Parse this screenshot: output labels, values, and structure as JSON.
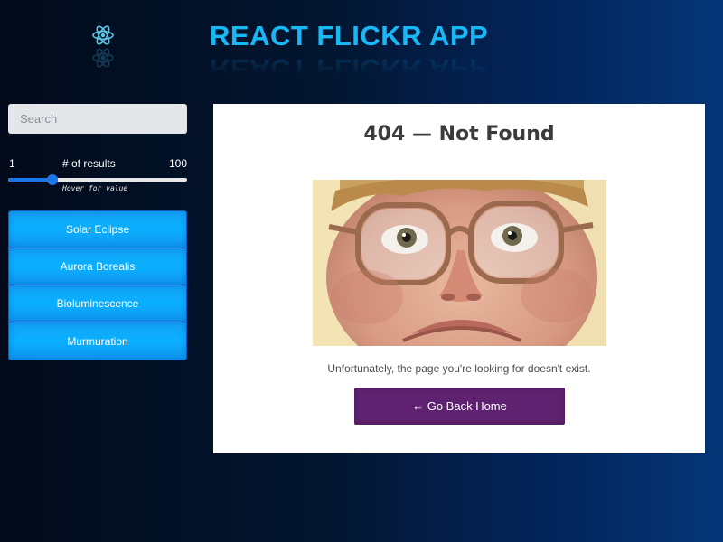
{
  "header": {
    "title": "REACT FLICKR APP",
    "logo_icon": "react-atom-icon"
  },
  "search": {
    "placeholder": "Search",
    "value": "",
    "button_icon": "magnifier-icon"
  },
  "results_slider": {
    "min": "1",
    "label": "# of results",
    "max": "100",
    "value": 24,
    "hint": "Hover for value"
  },
  "topics": [
    {
      "label": "Solar Eclipse"
    },
    {
      "label": "Aurora Borealis"
    },
    {
      "label": "Bioluminescence"
    },
    {
      "label": "Murmuration"
    }
  ],
  "not_found": {
    "title": "404 — Not Found",
    "image_alt": "Man with thick glasses frowning",
    "message": "Unfortunately, the page you're looking for doesn't exist.",
    "button_label": "← Go Back Home"
  },
  "colors": {
    "accent": "#18b7f6",
    "topic_button": "#0ab0ff",
    "home_button": "#5e2270",
    "slider": "#1a78e6"
  }
}
